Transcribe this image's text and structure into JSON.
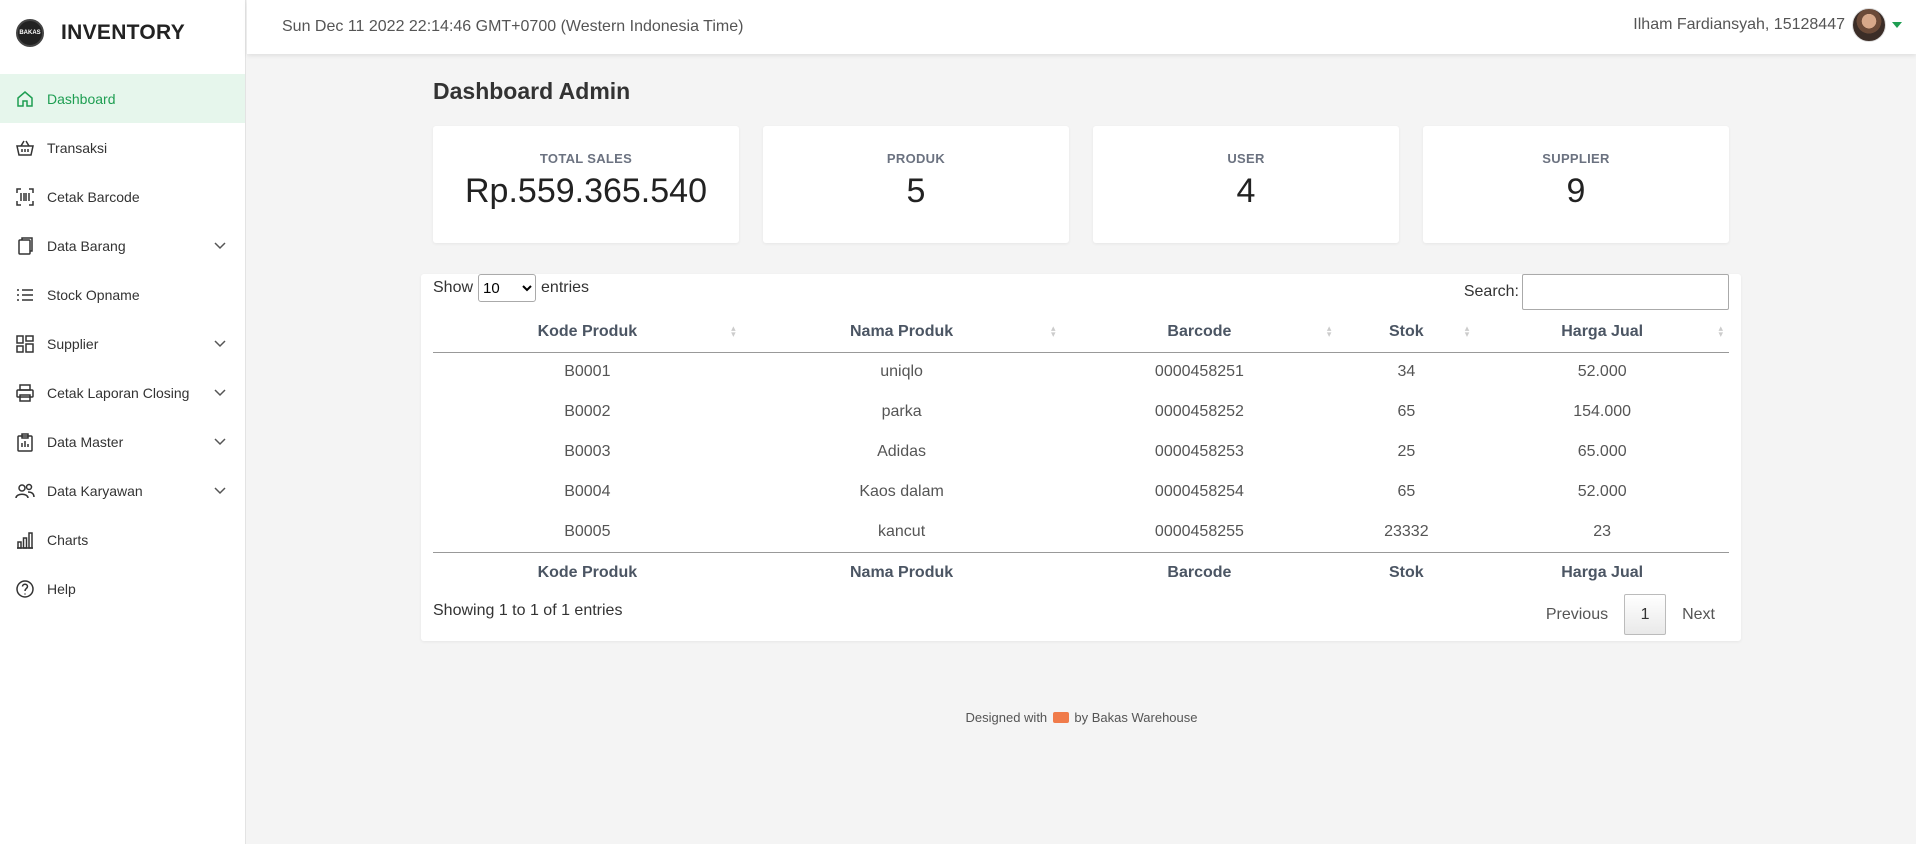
{
  "brand": {
    "logo_text": "BAKAS",
    "title": "INVENTORY"
  },
  "sidebar": {
    "items": [
      {
        "label": "Dashboard",
        "icon": "home-icon",
        "active": true,
        "has_submenu": false
      },
      {
        "label": "Transaksi",
        "icon": "basket-icon",
        "active": false,
        "has_submenu": false
      },
      {
        "label": "Cetak Barcode",
        "icon": "barcode-icon",
        "active": false,
        "has_submenu": false
      },
      {
        "label": "Data Barang",
        "icon": "files-icon",
        "active": false,
        "has_submenu": true
      },
      {
        "label": "Stock Opname",
        "icon": "list-icon",
        "active": false,
        "has_submenu": false
      },
      {
        "label": "Supplier",
        "icon": "grid-icon",
        "active": false,
        "has_submenu": true
      },
      {
        "label": "Cetak Laporan Closing",
        "icon": "printer-icon",
        "active": false,
        "has_submenu": true
      },
      {
        "label": "Data Master",
        "icon": "clipboard-icon",
        "active": false,
        "has_submenu": true
      },
      {
        "label": "Data Karyawan",
        "icon": "people-icon",
        "active": false,
        "has_submenu": true
      },
      {
        "label": "Charts",
        "icon": "bar-chart-icon",
        "active": false,
        "has_submenu": false
      },
      {
        "label": "Help",
        "icon": "question-icon",
        "active": false,
        "has_submenu": false
      }
    ]
  },
  "header": {
    "datetime": "Sun Dec 11 2022 22:14:46 GMT+0700 (Western Indonesia Time)",
    "user_name": "Ilham Fardiansyah, 15128447"
  },
  "main": {
    "title": "Dashboard Admin",
    "cards": [
      {
        "label": "TOTAL SALES",
        "value": "Rp.559.365.540"
      },
      {
        "label": "PRODUK",
        "value": "5"
      },
      {
        "label": "USER",
        "value": "4"
      },
      {
        "label": "SUPPLIER",
        "value": "9"
      }
    ]
  },
  "table": {
    "show_label": "Show",
    "entries_label": "entries",
    "page_length": "10",
    "page_length_options": [
      "10"
    ],
    "search_label": "Search:",
    "search_value": "",
    "columns": [
      "Kode Produk",
      "Nama Produk",
      "Barcode",
      "Stok",
      "Harga Jual"
    ],
    "rows": [
      [
        "B0001",
        "uniqlo",
        "0000458251",
        "34",
        "52.000"
      ],
      [
        "B0002",
        "parka",
        "0000458252",
        "65",
        "154.000"
      ],
      [
        "B0003",
        "Adidas",
        "0000458253",
        "25",
        "65.000"
      ],
      [
        "B0004",
        "Kaos dalam",
        "0000458254",
        "65",
        "52.000"
      ],
      [
        "B0005",
        "kancut",
        "0000458255",
        "23332",
        "23"
      ]
    ],
    "info": "Showing 1 to 1 of 1 entries",
    "pagination": {
      "previous": "Previous",
      "current": "1",
      "next": "Next"
    }
  },
  "footer": {
    "prefix": "Designed with",
    "suffix": "by Bakas Warehouse",
    "icon": "truck-icon"
  },
  "colors": {
    "accent": "#1e9e52",
    "active_bg": "#e6f6ec",
    "truck": "#f07b4a"
  }
}
